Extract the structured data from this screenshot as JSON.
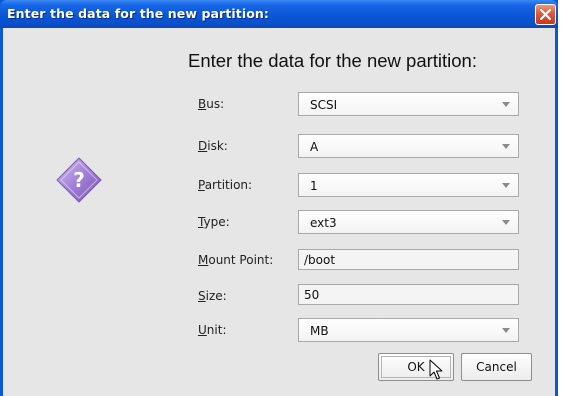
{
  "window": {
    "title": "Enter the data for the new partition:"
  },
  "dialog": {
    "heading": "Enter the data for the new partition:",
    "icon": "question-diamond-icon"
  },
  "fields": {
    "bus": {
      "mnemonic": "B",
      "rest": "us:",
      "value": "SCSI"
    },
    "disk": {
      "mnemonic": "D",
      "rest": "isk:",
      "value": "A"
    },
    "partition": {
      "mnemonic": "P",
      "rest": "artition:",
      "value": "1"
    },
    "type": {
      "mnemonic": "T",
      "rest": "ype:",
      "value": "ext3"
    },
    "mountpoint": {
      "mnemonic": "M",
      "rest": "ount Point:",
      "value": "/boot"
    },
    "size": {
      "mnemonic": "S",
      "rest": "ize:",
      "value": "50"
    },
    "unit": {
      "mnemonic": "U",
      "rest": "nit:",
      "value": "MB"
    }
  },
  "buttons": {
    "ok": "OK",
    "cancel": "Cancel"
  },
  "colors": {
    "titlebar": "#0a57d8",
    "client_bg": "#e6e6e6",
    "icon_purple": "#9b72cf",
    "close_red": "#e0573a"
  }
}
